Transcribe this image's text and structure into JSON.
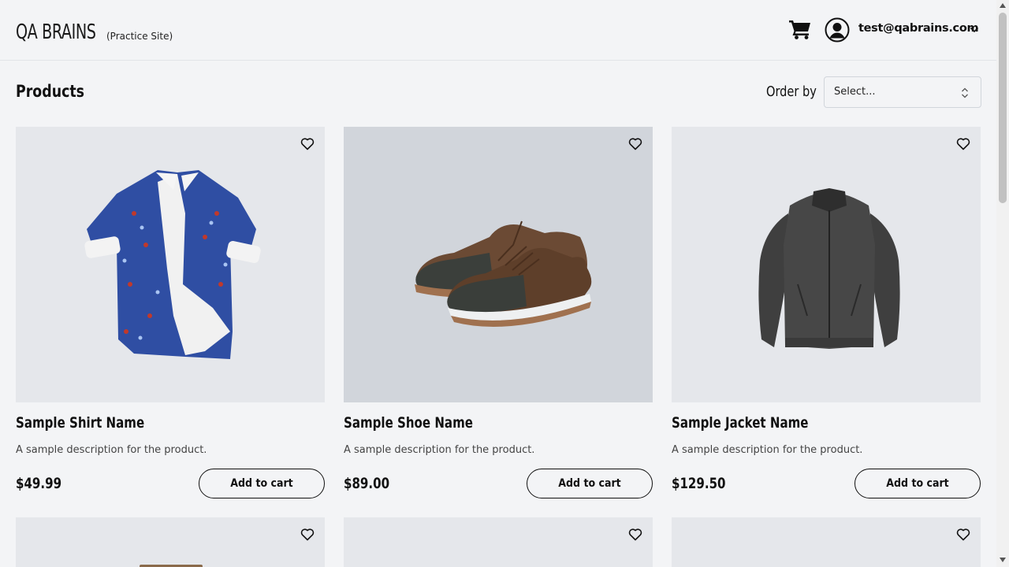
{
  "header": {
    "logo_main": "QA BRAINS",
    "logo_sub": "(Practice Site)",
    "user_email": "test@qabrains.com",
    "icons": [
      "cart-icon",
      "user-avatar-icon",
      "chevron-down-icon"
    ]
  },
  "toolbar": {
    "title": "Products",
    "order_label": "Order by",
    "order_select": {
      "value": "Select...",
      "icon": "up-down-chevron-icon"
    }
  },
  "products": [
    {
      "name": "Sample Shirt Name",
      "description": "A sample description for the product.",
      "price": "$49.99",
      "button": "Add to cart",
      "image": "shirt-image",
      "image_bg": "#e5e7eb"
    },
    {
      "name": "Sample Shoe Name",
      "description": "A sample description for the product.",
      "price": "$89.00",
      "button": "Add to cart",
      "image": "shoe-image",
      "image_bg": "#d1d5db"
    },
    {
      "name": "Sample Jacket Name",
      "description": "A sample description for the product.",
      "price": "$129.50",
      "button": "Add to cart",
      "image": "jacket-image",
      "image_bg": "#e5e7eb"
    }
  ],
  "colors": {
    "page_bg": "#f3f4f6",
    "text": "#111111",
    "card_bg": "#e5e7eb",
    "border": "#d1d5db"
  }
}
